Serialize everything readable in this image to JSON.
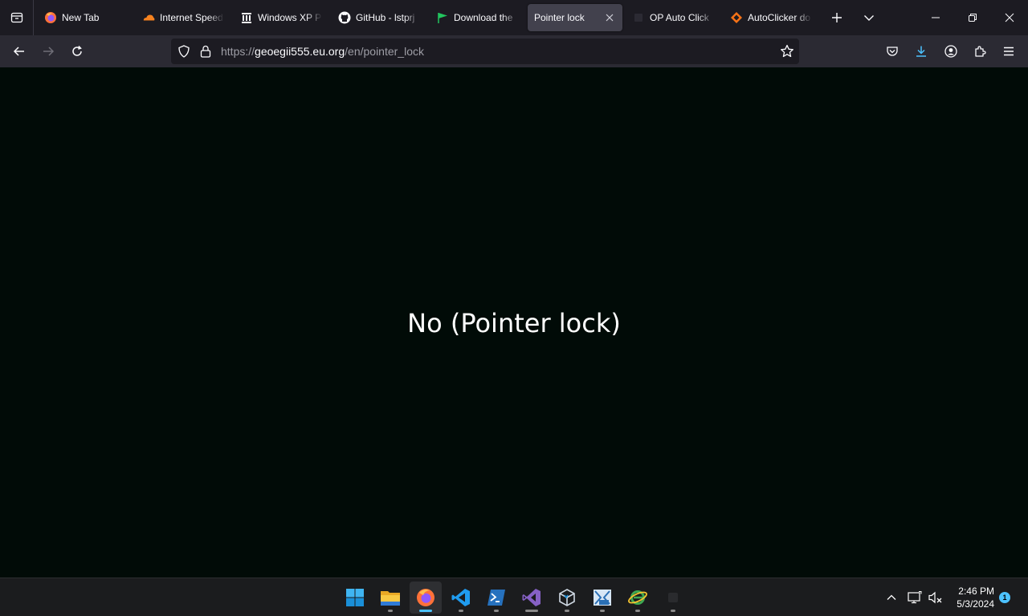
{
  "browser": {
    "tabs": [
      {
        "title": "New Tab",
        "icon": "firefox-icon",
        "active": false
      },
      {
        "title": "Internet Speed",
        "icon": "cloudflare-icon",
        "active": false
      },
      {
        "title": "Windows XP P",
        "icon": "archive-org-icon",
        "active": false
      },
      {
        "title": "GitHub - lstprj",
        "icon": "github-icon",
        "active": false
      },
      {
        "title": "Download the",
        "icon": "green-flag-icon",
        "active": false
      },
      {
        "title": "Pointer lock",
        "icon": "",
        "active": true
      },
      {
        "title": "OP Auto Click",
        "icon": "blank-icon",
        "active": false
      },
      {
        "title": "AutoClicker do",
        "icon": "autoclicker-icon",
        "active": false
      }
    ],
    "url_prefix": "https://",
    "url_domain": "geoegii555.eu.org",
    "url_path": "/en/pointer_lock"
  },
  "page": {
    "message": "No (Pointer lock)"
  },
  "taskbar": {
    "apps": [
      {
        "name": "start",
        "icon": "windows-start-icon"
      },
      {
        "name": "file-explorer",
        "icon": "folder-icon"
      },
      {
        "name": "firefox",
        "icon": "firefox-icon"
      },
      {
        "name": "vscode",
        "icon": "vscode-icon"
      },
      {
        "name": "powershell",
        "icon": "powershell-icon"
      },
      {
        "name": "visual-studio",
        "icon": "visual-studio-icon"
      },
      {
        "name": "virtualbox",
        "icon": "virtualbox-icon"
      },
      {
        "name": "msys2",
        "icon": "msys2-icon"
      },
      {
        "name": "internet-explorer",
        "icon": "ie-icon"
      },
      {
        "name": "blank-app",
        "icon": "blank-icon"
      }
    ],
    "time": "2:46 PM",
    "date": "5/3/2024",
    "notification_count": "1"
  },
  "colors": {
    "accent": "#4cc2ff",
    "page_background": "#010b07"
  }
}
